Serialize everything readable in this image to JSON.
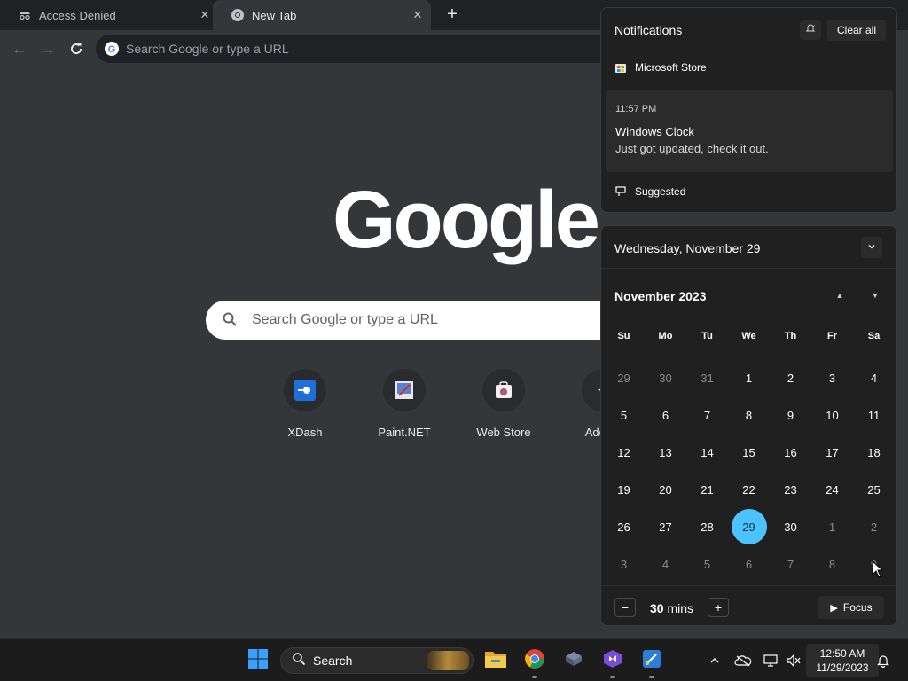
{
  "browser": {
    "tabs": [
      {
        "title": "Access Denied",
        "active": false,
        "icon": "spy-icon"
      },
      {
        "title": "New Tab",
        "active": true,
        "icon": "chrome-icon"
      }
    ],
    "omnibox_placeholder": "Search Google or type a URL"
  },
  "ntp": {
    "logo_text": "Google",
    "search_placeholder": "Search Google or type a URL",
    "shortcuts": [
      {
        "label": "XDash",
        "icon": "xdash-icon"
      },
      {
        "label": "Paint.NET",
        "icon": "paintnet-icon"
      },
      {
        "label": "Web Store",
        "icon": "webstore-icon"
      },
      {
        "label": "Add sh",
        "icon": "plus-icon"
      }
    ]
  },
  "notifications": {
    "title": "Notifications",
    "clear_all": "Clear all",
    "app_name": "Microsoft Store",
    "card": {
      "time": "11:57 PM",
      "title": "Windows Clock",
      "body": "Just got updated, check it out."
    },
    "suggested": "Suggested"
  },
  "calendar": {
    "date_header": "Wednesday, November 29",
    "month_title": "November 2023",
    "weekdays": [
      "Su",
      "Mo",
      "Tu",
      "We",
      "Th",
      "Fr",
      "Sa"
    ],
    "weeks": [
      [
        "29",
        "30",
        "31",
        "1",
        "2",
        "3",
        "4"
      ],
      [
        "5",
        "6",
        "7",
        "8",
        "9",
        "10",
        "11"
      ],
      [
        "12",
        "13",
        "14",
        "15",
        "16",
        "17",
        "18"
      ],
      [
        "19",
        "20",
        "21",
        "22",
        "23",
        "24",
        "25"
      ],
      [
        "26",
        "27",
        "28",
        "29",
        "30",
        "1",
        "2"
      ],
      [
        "3",
        "4",
        "5",
        "6",
        "7",
        "8",
        "9"
      ]
    ],
    "today": "29",
    "focus": {
      "minutes_value": "30",
      "minutes_unit": "mins",
      "start_label": "Focus"
    }
  },
  "taskbar": {
    "search_label": "Search",
    "time": "12:50 AM",
    "date": "11/29/2023"
  },
  "colors": {
    "accent": "#4cc2ff",
    "panel_bg": "#202020",
    "browser_bg": "#35363a"
  }
}
